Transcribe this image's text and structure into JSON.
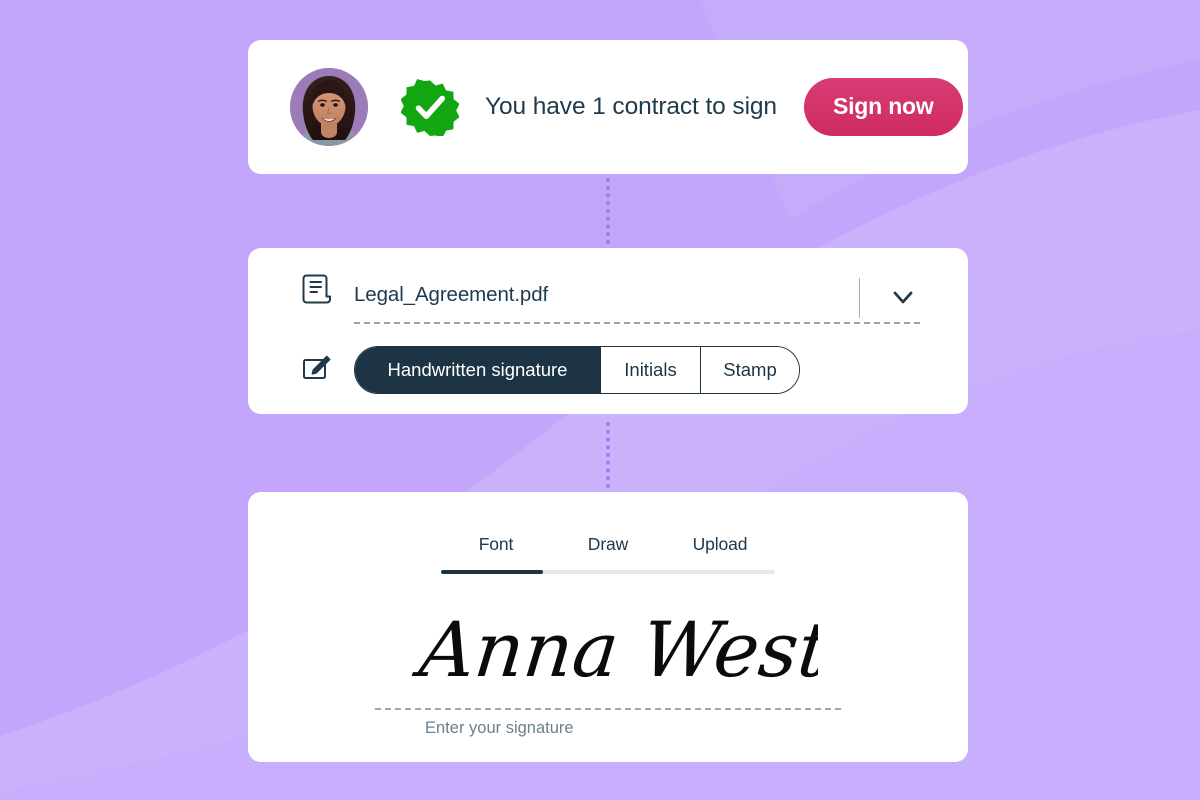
{
  "theme": {
    "background_purple": "#c3a6fb",
    "background_wave_light": "#cdb4fc",
    "card_white": "#ffffff",
    "accent_pink": "#cf2a63",
    "accent_green": "#13a610",
    "ink_navy": "#1c3443",
    "muted_gray": "#6e7f8c",
    "connector_purple": "#9f7df0"
  },
  "notification_card": {
    "avatar": {
      "icon": "user-avatar-photo",
      "alt": "Smiling woman with dark hair on purple background"
    },
    "badge": {
      "icon": "verified-check-badge",
      "color": "#13a610"
    },
    "message": "You have 1 contract to sign",
    "sign_button": {
      "label": "Sign now",
      "color": "#cf2a63"
    }
  },
  "document_card": {
    "doc_icon": "document-scroll-icon",
    "file_name": "Legal_Agreement.pdf",
    "dropdown_icon": "chevron-down-icon",
    "pen_icon": "pen-edit-icon",
    "signature_types": [
      {
        "label": "Handwritten signature",
        "active": true
      },
      {
        "label": "Initials",
        "active": false
      },
      {
        "label": "Stamp",
        "active": false
      }
    ]
  },
  "signature_card": {
    "tabs": [
      {
        "label": "Font",
        "active": true
      },
      {
        "label": "Draw",
        "active": false
      },
      {
        "label": "Upload",
        "active": false
      }
    ],
    "signature_value": "Anna West",
    "signature_hint": "Enter your signature"
  }
}
